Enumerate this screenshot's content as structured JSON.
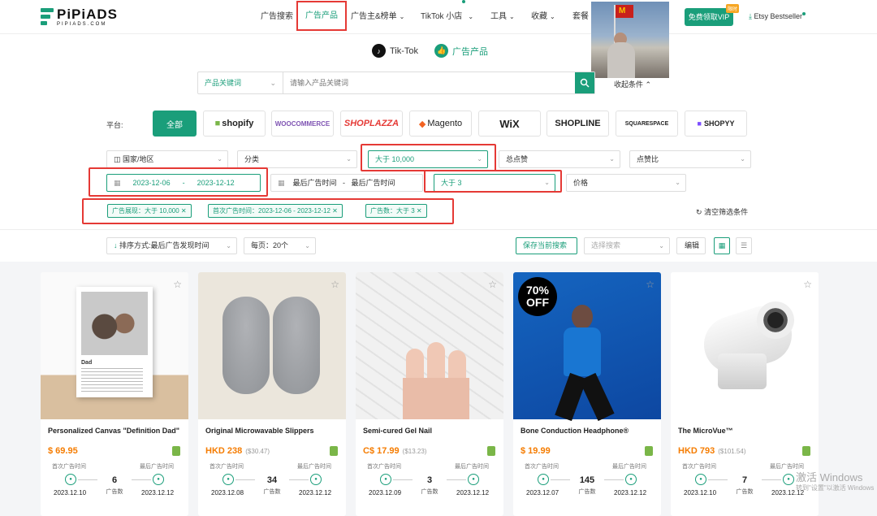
{
  "logo": {
    "name": "PiPiADS",
    "sub": "PIPIADS.COM"
  },
  "nav": {
    "items": [
      "广告搜索",
      "广告产品",
      "广告主&榜单",
      "TikTok 小店",
      "工具",
      "收藏",
      "套餐"
    ],
    "vip": "免费领取VIP",
    "vip_badge": "限时",
    "etsy": "Etsy Bestseller"
  },
  "tabs": [
    "Tik-Tok",
    "广告产品"
  ],
  "search": {
    "select": "产品关键词",
    "placeholder": "请输入产品关键词",
    "collapse": "收起条件"
  },
  "platforms": {
    "label": "平台:",
    "items": [
      "全部",
      "shopify",
      "WOOCOMMERCE",
      "SHOPLAZZA",
      "Magento",
      "WiX",
      "SHOPLINE",
      "SQUARESPACE",
      "SHOPYY"
    ]
  },
  "filters": {
    "country": "国家/地区",
    "category": "分类",
    "impressions": "大于 10,000",
    "likes": "总点赞",
    "like_ratio": "点赞比",
    "first_date": "2023-12-06",
    "last_date": "2023-12-12",
    "last_ad_time": "最后广告时间",
    "last_ad_time2": "最后广告时间",
    "ad_count": "大于 3",
    "price": "价格"
  },
  "chips": [
    "广告展现：大于 10,000",
    "首次广告时间：2023-12-06 - 2023-12-12",
    "广告数：大于 3"
  ],
  "clear": "清空筛选条件",
  "toolbar": {
    "sort": "排序方式:最后广告发现时间",
    "per_page": "每页：20个",
    "save": "保存当前搜索",
    "select_search": "选择搜索",
    "edit": "编辑"
  },
  "labels": {
    "first": "首次广告时间",
    "last": "最后广告时间",
    "count": "广告数"
  },
  "cards": [
    {
      "title": "Personalized Canvas \"Definition Dad\"",
      "price": "$ 69.95",
      "orig": "",
      "count": "6",
      "first": "2023.12.10",
      "last": "2023.12.12"
    },
    {
      "title": "Original Microwavable Slippers",
      "price": "HKD 238",
      "orig": "($30.47)",
      "count": "34",
      "first": "2023.12.08",
      "last": "2023.12.12"
    },
    {
      "title": "Semi-cured Gel Nail",
      "price": "C$ 17.99",
      "orig": "($13.23)",
      "count": "3",
      "first": "2023.12.09",
      "last": "2023.12.12"
    },
    {
      "title": "Bone Conduction Headphone®",
      "price": "$ 19.99",
      "orig": "",
      "count": "145",
      "first": "2023.12.07",
      "last": "2023.12.12"
    },
    {
      "title": "The MicroVue™",
      "price": "HKD 793",
      "orig": "($101.54)",
      "count": "7",
      "first": "2023.12.10",
      "last": "2023.12.12"
    }
  ],
  "badge70": {
    "line1": "70%",
    "line2": "OFF"
  },
  "canvas_text": "Dad",
  "watermark": {
    "line1": "激活 Windows",
    "line2": "转到\"设置\"以激活 Windows"
  }
}
